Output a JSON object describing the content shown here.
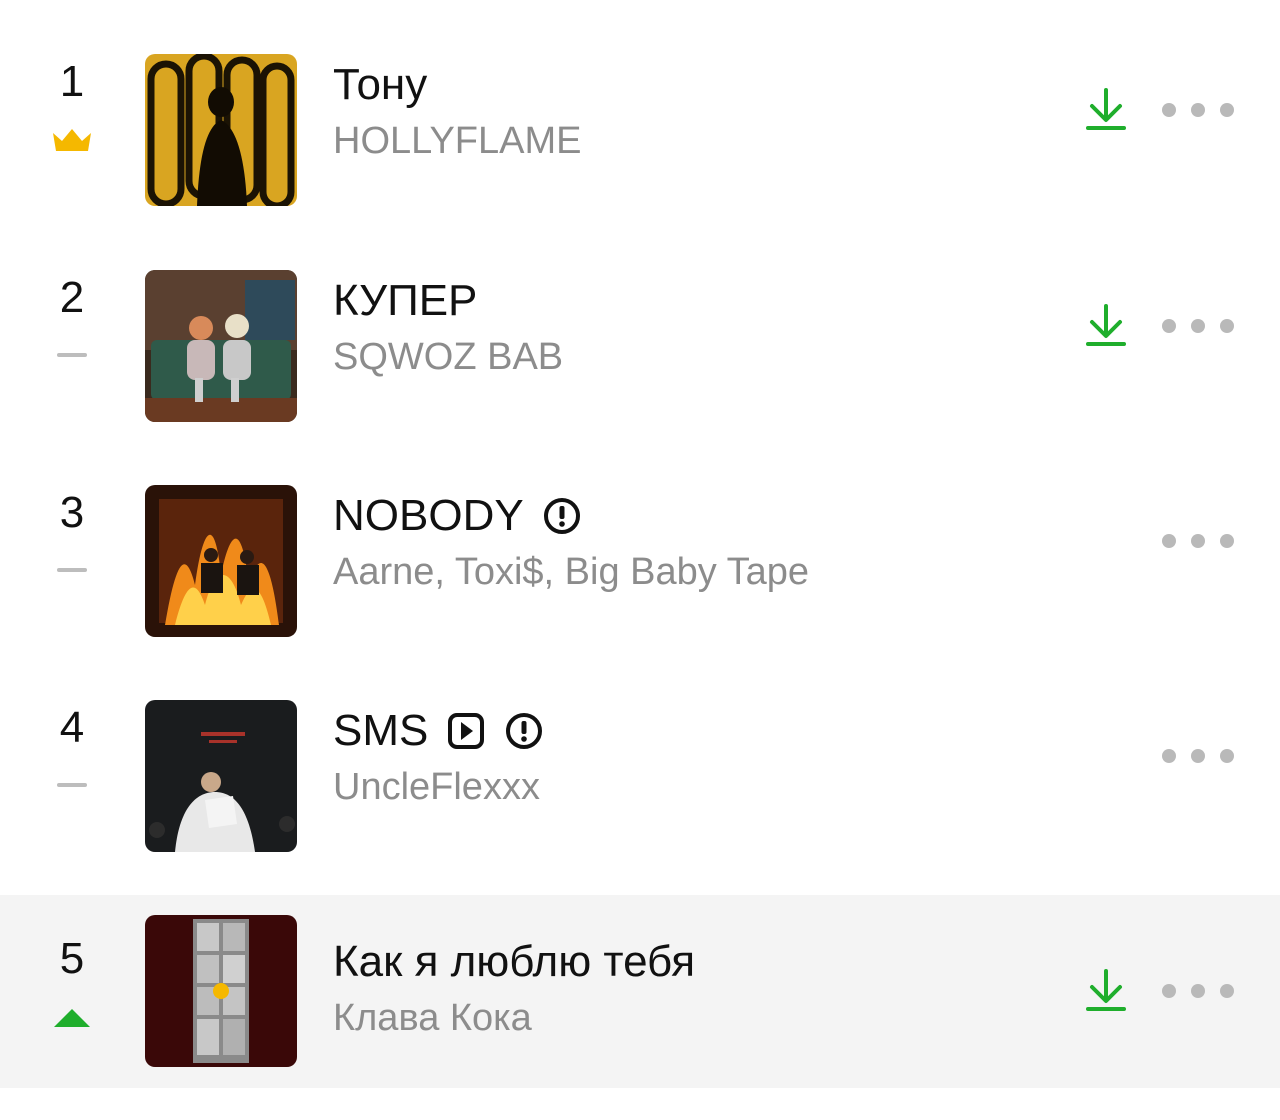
{
  "colors": {
    "download": "#1fae2c",
    "crown": "#f5b800",
    "up": "#1fae2c",
    "muted": "#bdbdbd"
  },
  "tracks": [
    {
      "rank": "1",
      "title": "Тону",
      "artist": "HOLLYFLAME",
      "trend": "crown",
      "download": true,
      "explicit": false,
      "video": false
    },
    {
      "rank": "2",
      "title": "КУПЕР",
      "artist": "SQWOZ BAB",
      "trend": "same",
      "download": true,
      "explicit": false,
      "video": false
    },
    {
      "rank": "3",
      "title": "NOBODY",
      "artist": "Aarne, Toxi$, Big Baby Tape",
      "trend": "same",
      "download": false,
      "explicit": true,
      "video": false
    },
    {
      "rank": "4",
      "title": "SMS",
      "artist": "UncleFlexxx",
      "trend": "same",
      "download": false,
      "explicit": true,
      "video": true
    },
    {
      "rank": "5",
      "title": "Как я люблю тебя",
      "artist": "Клава Кока",
      "trend": "up",
      "download": true,
      "explicit": false,
      "video": false
    }
  ],
  "icons": {
    "crown": "crown-icon",
    "same": "no-change-dash-icon",
    "up": "trend-up-arrow-icon",
    "download": "download-icon",
    "more": "more-dots-icon",
    "explicit": "explicit-warning-icon",
    "video": "video-clip-icon"
  }
}
